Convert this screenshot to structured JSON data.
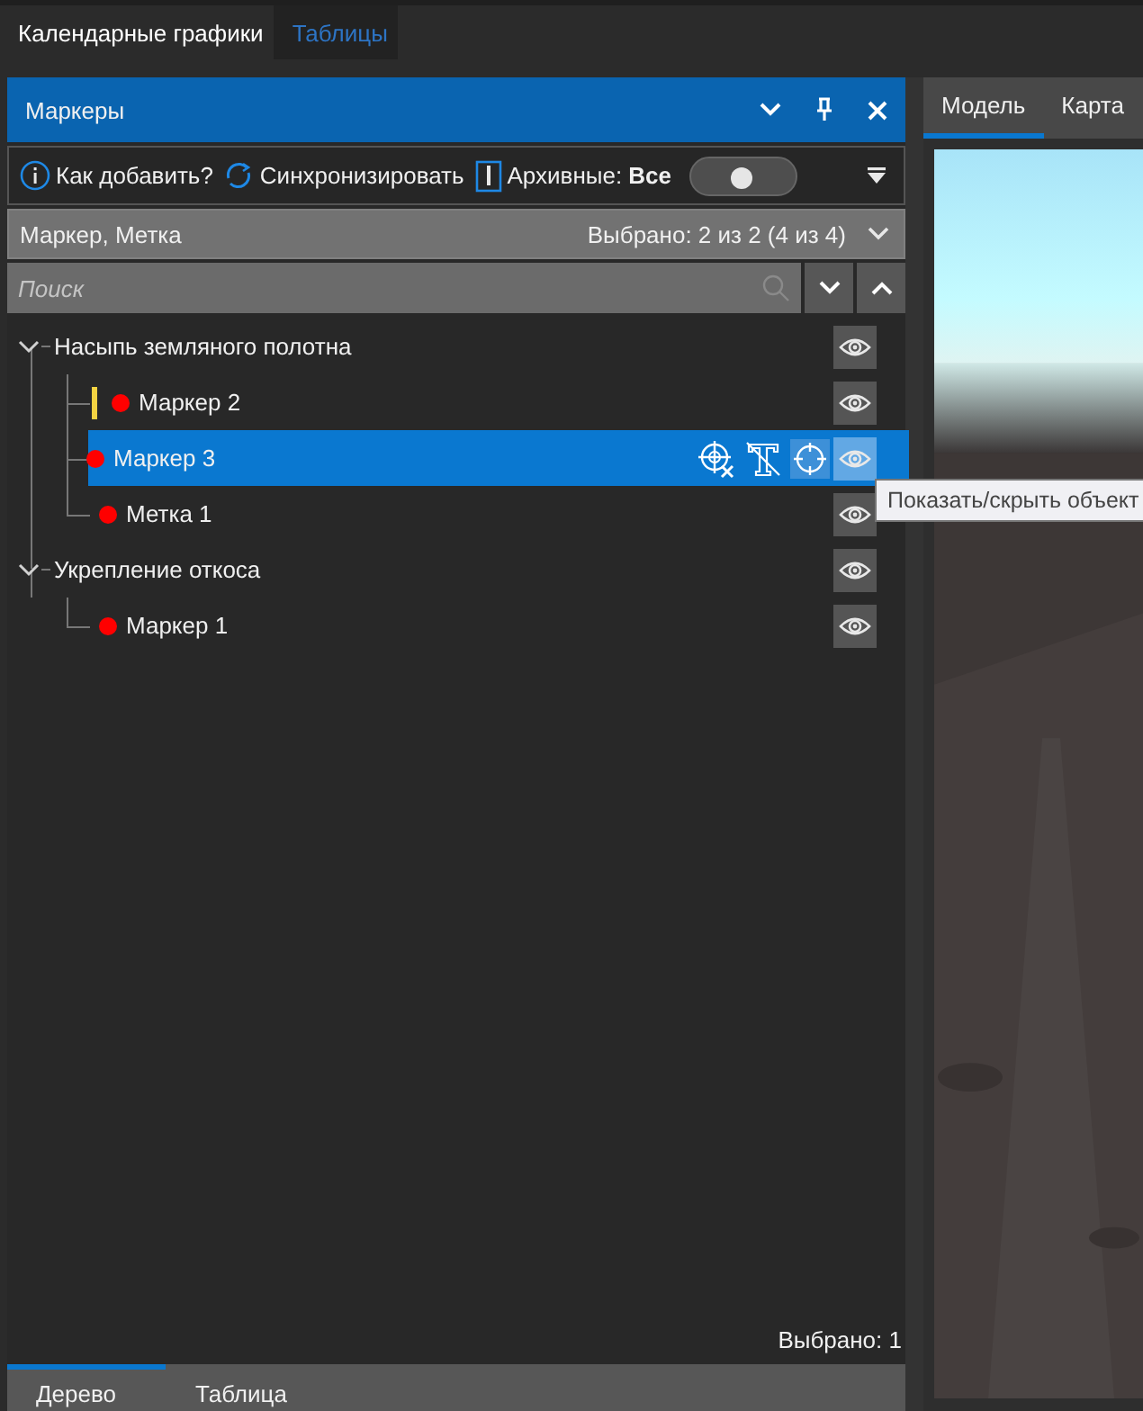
{
  "top_tabs": [
    {
      "label": "Календарные графики",
      "selected": true
    },
    {
      "label": "Таблицы",
      "selected": false
    }
  ],
  "panel": {
    "title": "Маркеры"
  },
  "toolbar": {
    "help": "Как добавить?",
    "sync": "Синхронизировать",
    "archive": "Архивные: **Все**",
    "archive_on": false
  },
  "filter": {
    "label": "Маркер, Метка",
    "summary": "Выбрано: 2 из 2 (4 из 4)"
  },
  "search": {
    "placeholder": "Поиск"
  },
  "tree": [
    {
      "label": "Насыпь земляного полотна",
      "expanded": true,
      "selected": false,
      "children": [
        {
          "label": "Маркер 2",
          "color": "#ff0000",
          "flagged": true,
          "selected": false
        },
        {
          "label": "Маркер 3",
          "color": "#ff0000",
          "flagged": false,
          "selected": true
        },
        {
          "label": "Метка 1",
          "color": "#ff0000",
          "flagged": false,
          "selected": false
        }
      ]
    },
    {
      "label": "Укрепление откоса",
      "expanded": true,
      "selected": false,
      "children": [
        {
          "label": "Маркер 1",
          "color": "#ff0000",
          "flagged": false,
          "selected": false
        }
      ]
    }
  ],
  "tooltip": "Показать/скрыть объект",
  "status": "Выбрано: 1",
  "bottom_tabs": [
    {
      "label": "Дерево",
      "selected": true
    },
    {
      "label": "Таблица",
      "selected": false
    }
  ],
  "view_tabs": [
    {
      "label": "Модель",
      "selected": true
    },
    {
      "label": "Карта",
      "selected": false
    }
  ]
}
